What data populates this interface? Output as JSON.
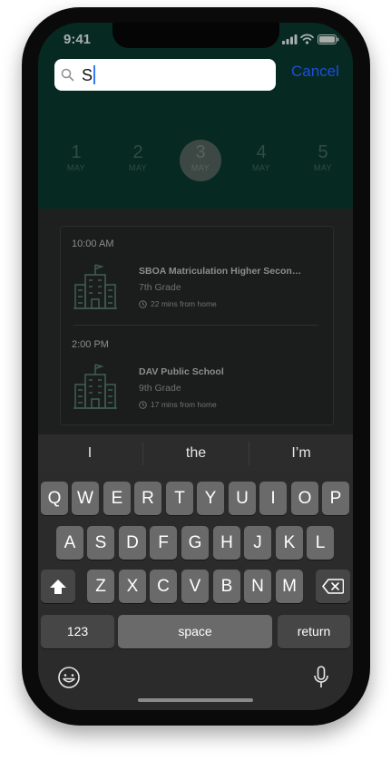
{
  "status": {
    "time": "9:41"
  },
  "search": {
    "value": "S",
    "cancel_label": "Cancel"
  },
  "dates": [
    {
      "day": "1",
      "month": "MAY",
      "selected": false
    },
    {
      "day": "2",
      "month": "MAY",
      "selected": false
    },
    {
      "day": "3",
      "month": "MAY",
      "selected": true
    },
    {
      "day": "4",
      "month": "MAY",
      "selected": false
    },
    {
      "day": "5",
      "month": "MAY",
      "selected": false
    }
  ],
  "schedule": [
    {
      "time": "10:00 AM",
      "school": "SBOA Matriculation Higher Secon…",
      "grade": "7th Grade",
      "distance": "22 mins from home"
    },
    {
      "time": "2:00 PM",
      "school": "DAV Public School",
      "grade": "9th Grade",
      "distance": "17 mins from home"
    }
  ],
  "suggestions": [
    "I",
    "the",
    "I’m"
  ],
  "keyboard": {
    "row1": [
      "Q",
      "W",
      "E",
      "R",
      "T",
      "Y",
      "U",
      "I",
      "O",
      "P"
    ],
    "row2": [
      "A",
      "S",
      "D",
      "F",
      "G",
      "H",
      "J",
      "K",
      "L"
    ],
    "row3": [
      "Z",
      "X",
      "C",
      "V",
      "B",
      "N",
      "M"
    ],
    "numbers_label": "123",
    "space_label": "space",
    "return_label": "return"
  },
  "icons": {
    "search": "search-icon",
    "shift": "shift-icon",
    "delete": "backspace-icon",
    "emoji": "emoji-icon",
    "mic": "microphone-icon",
    "school": "school-building-icon",
    "clock": "clock-icon"
  },
  "colors": {
    "header_bg": "#062a22",
    "accent_link": "#1d4ed8",
    "caret": "#2f7cf6"
  }
}
